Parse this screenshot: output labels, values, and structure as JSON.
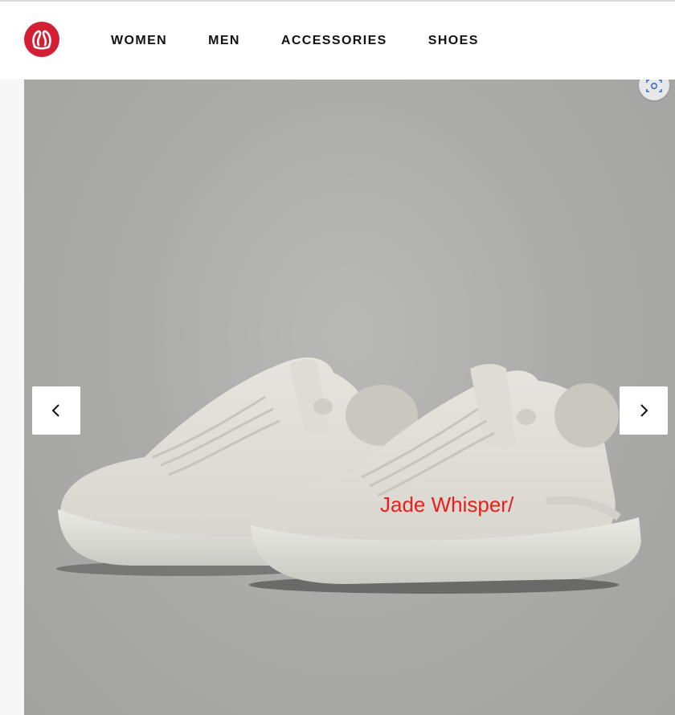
{
  "header": {
    "logo_icon": "lululemon-logo-icon",
    "brand_color": "#d31f34",
    "nav": [
      {
        "label": "WOMEN"
      },
      {
        "label": "MEN"
      },
      {
        "label": "ACCESSORIES"
      },
      {
        "label": "SHOES"
      }
    ]
  },
  "gallery": {
    "image_subject": "pair of off-white leather sneakers",
    "overlay_label": "Jade Whisper/",
    "overlay_color": "#e8201b",
    "visual_search_icon": "visual-search-icon",
    "prev_icon": "chevron-left-icon",
    "next_icon": "chevron-right-icon"
  }
}
